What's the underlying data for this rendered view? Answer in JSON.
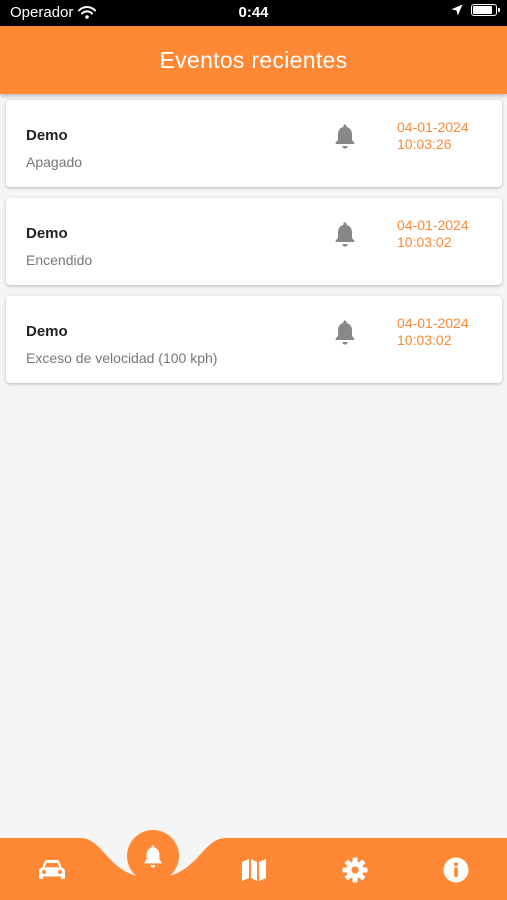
{
  "status_bar": {
    "carrier": "Operador",
    "time": "0:44",
    "battery_level": 0.8,
    "icons": [
      "wifi-icon",
      "location-arrow-icon",
      "battery-icon"
    ]
  },
  "header": {
    "title": "Eventos recientes"
  },
  "events": [
    {
      "name": "Demo",
      "description": "Apagado",
      "date": "04-01-2024",
      "time": "10:03:26",
      "icon": "bell-icon"
    },
    {
      "name": "Demo",
      "description": "Encendido",
      "date": "04-01-2024",
      "time": "10:03:02",
      "icon": "bell-icon"
    },
    {
      "name": "Demo",
      "description": "Exceso de velocidad (100 kph)",
      "date": "04-01-2024",
      "time": "10:03:02",
      "icon": "bell-icon"
    }
  ],
  "bottom_nav": {
    "items": [
      "car-icon",
      "bell-icon",
      "map-icon",
      "gear-icon",
      "info-icon"
    ],
    "active": "bell-icon"
  },
  "colors": {
    "accent": "#fe8833",
    "background": "#f5f5f5",
    "card": "#ffffff",
    "muted_icon": "#888888"
  }
}
